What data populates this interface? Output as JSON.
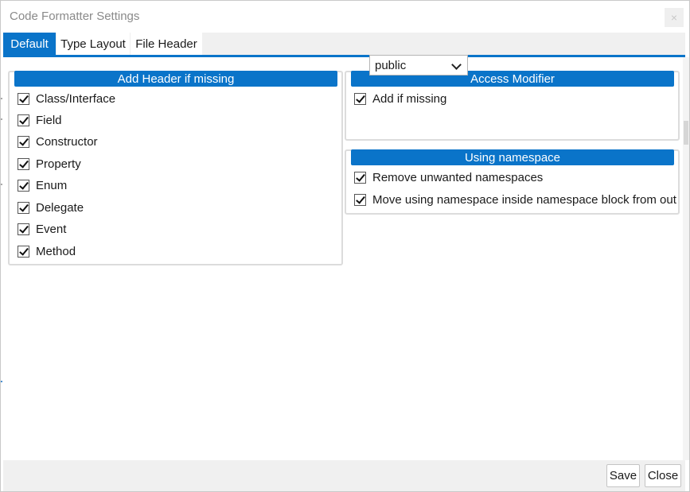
{
  "window": {
    "title": "Code Formatter Settings",
    "close_glyph": "×"
  },
  "tabs": [
    {
      "label": "Default",
      "active": true
    },
    {
      "label": "Type Layout",
      "active": false
    },
    {
      "label": "File Header",
      "active": false
    }
  ],
  "add_header": {
    "title": "Add Header if missing",
    "items": [
      {
        "label": "Class/Interface",
        "checked": true
      },
      {
        "label": "Field",
        "checked": true
      },
      {
        "label": "Constructor",
        "checked": true
      },
      {
        "label": "Property",
        "checked": true
      },
      {
        "label": "Enum",
        "checked": true
      },
      {
        "label": "Delegate",
        "checked": true
      },
      {
        "label": "Event",
        "checked": true
      },
      {
        "label": "Method",
        "checked": true
      }
    ]
  },
  "access_modifier": {
    "title": "Access Modifier",
    "add_if_missing": {
      "label": "Add if missing",
      "checked": true
    },
    "select_value": "public"
  },
  "using_namespace": {
    "title": "Using namespace",
    "items": [
      {
        "label": "Remove unwanted namespaces",
        "checked": true
      },
      {
        "label": "Move using namespace inside namespace block from out",
        "checked": true
      }
    ]
  },
  "footer": {
    "save_label": "Save",
    "close_label": "Close"
  },
  "colors": {
    "accent": "#0a74c9",
    "footer_bg": "#f0f0f0"
  }
}
